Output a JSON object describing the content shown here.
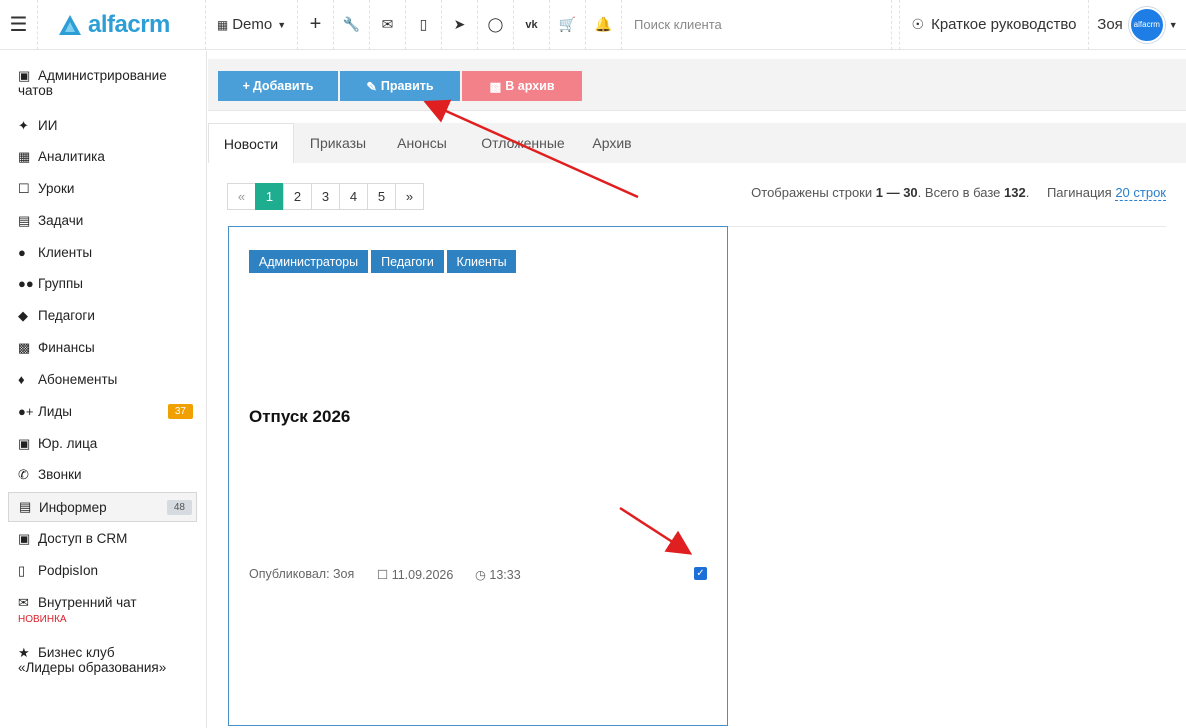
{
  "topbar": {
    "brand": "alfacrm",
    "branch": "Demo",
    "search_placeholder": "Поиск клиента",
    "guide": "Краткое руководство",
    "user": "Зоя",
    "avatar_text": "alfacrm"
  },
  "sidebar": {
    "items": [
      {
        "label": "Администрирование",
        "label2": "чатов",
        "icon": "chats-icon"
      },
      {
        "label": "ИИ",
        "icon": "sparkle-icon"
      },
      {
        "label": "Аналитика",
        "icon": "map-icon"
      },
      {
        "label": "Уроки",
        "icon": "calendar-icon"
      },
      {
        "label": "Задачи",
        "icon": "clipboard-icon"
      },
      {
        "label": "Клиенты",
        "icon": "user-icon"
      },
      {
        "label": "Группы",
        "icon": "users-icon"
      },
      {
        "label": "Педагоги",
        "icon": "graduation-cap-icon"
      },
      {
        "label": "Финансы",
        "icon": "money-icon"
      },
      {
        "label": "Абонементы",
        "icon": "tag-icon"
      },
      {
        "label": "Лиды",
        "icon": "user-plus-icon",
        "badge": "37"
      },
      {
        "label": "Юр. лица",
        "icon": "briefcase-icon"
      },
      {
        "label": "Звонки",
        "icon": "phone-icon"
      },
      {
        "label": "Информер",
        "icon": "newspaper-icon",
        "badge": "48"
      },
      {
        "label": "Доступ в CRM",
        "icon": "lock-icon"
      },
      {
        "label": "PodpisIon",
        "icon": "document-icon"
      },
      {
        "label": "Внутренний чат",
        "icon": "envelope-icon",
        "tag": "НОВИНКА"
      },
      {
        "label": "Бизнес клуб",
        "label2": "«Лидеры образования»",
        "icon": "star-icon"
      }
    ]
  },
  "toolbar": {
    "add": "Добавить",
    "edit": "Править",
    "archive": "В архив"
  },
  "tabs": [
    "Новости",
    "Приказы",
    "Анонсы",
    "Отложенные",
    "Архив"
  ],
  "pagination": {
    "prev": "«",
    "pages": [
      "1",
      "2",
      "3",
      "4",
      "5"
    ],
    "next": "»",
    "info_prefix": "Отображены строки ",
    "info_range": "1 — 30",
    "info_mid": ". Всего в базе ",
    "info_total": "132",
    "info_suffix": ".",
    "per_page_label": "Пагинация",
    "per_page_value": "20 строк"
  },
  "card": {
    "tags": [
      "Администраторы",
      "Педагоги",
      "Клиенты"
    ],
    "title": "Отпуск 2026",
    "author": "Опубликовал: Зоя",
    "date": "11.09.2026",
    "time": "13:33"
  },
  "colors": {
    "primary": "#4b9fd8",
    "danger": "#f2818a",
    "pager_active": "#1fad8f",
    "tag": "#2f82c2",
    "annotation": "#e02020"
  }
}
